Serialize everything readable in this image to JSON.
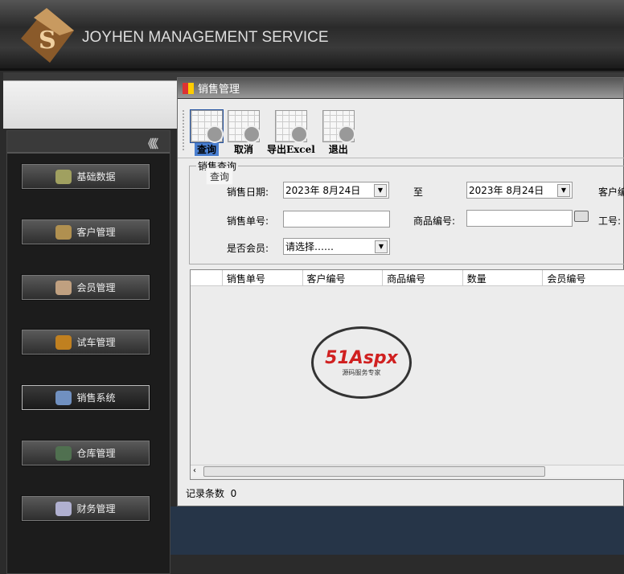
{
  "header": {
    "brand": "JOYHEN  MANAGEMENT SERVICE",
    "logo_letter": "S"
  },
  "sidebar": {
    "collapse": "《《《",
    "items": [
      {
        "label": "基础数据",
        "color": "#a0a060"
      },
      {
        "label": "客户管理",
        "color": "#b09050"
      },
      {
        "label": "会员管理",
        "color": "#c0a080"
      },
      {
        "label": "试车管理",
        "color": "#c08020"
      },
      {
        "label": "销售系统",
        "color": "#7090c0"
      },
      {
        "label": "仓库管理",
        "color": "#507050"
      },
      {
        "label": "财务管理",
        "color": "#b0b0d0"
      }
    ],
    "active": 4
  },
  "window": {
    "title": "销售管理",
    "toolbar": [
      {
        "label": "查询"
      },
      {
        "label": "取消"
      },
      {
        "label": "导出Excel"
      },
      {
        "label": "退出"
      }
    ],
    "group_title": "销售查询",
    "tooltip": "查询",
    "form": {
      "date_label": "销售日期:",
      "date_from": "2023年  8月24日",
      "to_label": "至",
      "date_to": "2023年  8月24日",
      "customer_label": "客户编",
      "order_label": "销售单号:",
      "order_value": "",
      "product_label": "商品编号:",
      "product_value": "",
      "staff_label": "工号:",
      "member_label": "是否会员:",
      "member_value": "请选择……"
    },
    "columns": [
      "",
      "销售单号",
      "客户编号",
      "商品编号",
      "数量",
      "会员编号"
    ],
    "watermark": {
      "brand": "51Aspx",
      "sub": "源码服务专家"
    },
    "status_label": "记录条数",
    "record_count": "0"
  }
}
